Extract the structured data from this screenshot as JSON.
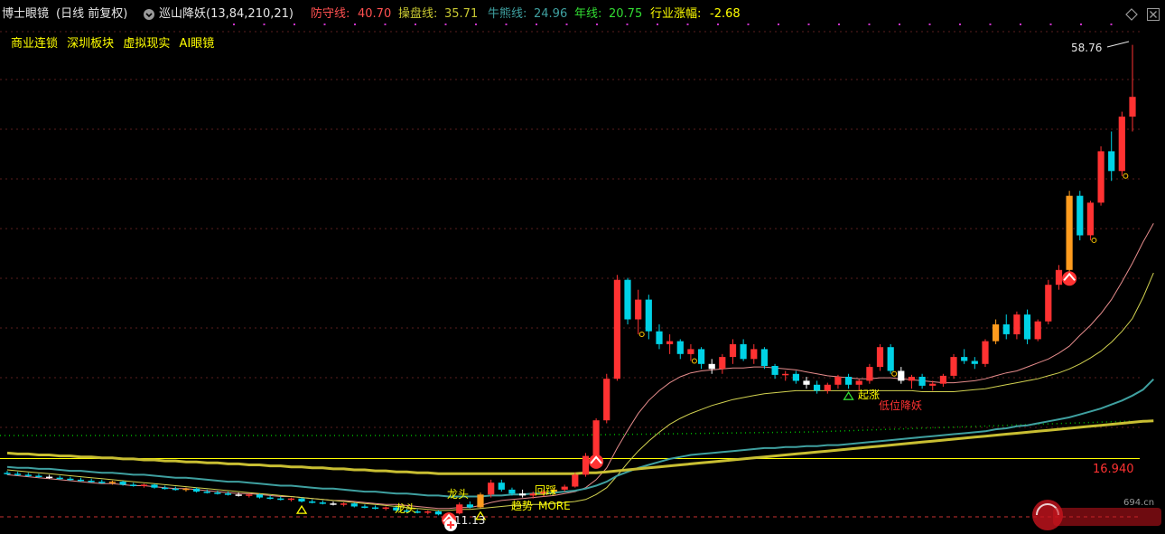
{
  "header": {
    "title": "博士眼镜",
    "period": "(日线 前复权)",
    "indicator_name": "巡山降妖(13,84,210,21)",
    "lines": [
      {
        "label": "防守线:",
        "value": "40.70",
        "color": "#ff5050"
      },
      {
        "label": "操盘线:",
        "value": "35.71",
        "color": "#c8c832"
      },
      {
        "label": "牛熊线:",
        "value": "24.96",
        "color": "#3fa0a0"
      },
      {
        "label": "年线:",
        "value": "20.75",
        "color": "#32dc32"
      },
      {
        "label": "行业涨幅:",
        "value": "-2.68",
        "color": "#ffff00"
      }
    ]
  },
  "tags": [
    "商业连锁",
    "深圳板块",
    "虚拟现实",
    "AI眼镜"
  ],
  "colors": {
    "up": "#ff3232",
    "down": "#00d2e6",
    "orange": "#ff9c1e",
    "defense": "#ff5050",
    "operate": "#c8c832",
    "bullbear": "#3fa0a0",
    "yearline": "#d2c832",
    "dotted": "#00b400"
  },
  "chart_data": {
    "type": "candlestick",
    "price_range": [
      10.5,
      60
    ],
    "max_label": "58.76",
    "min_label": "11.13",
    "level_label": "16.940",
    "level": 16.94,
    "annotations": [
      {
        "text": "龙头",
        "color": "#ffff00"
      },
      {
        "text": "龙头",
        "color": "#ffff00"
      },
      {
        "text": "回踩",
        "color": "#ffff00"
      },
      {
        "text": "趋势",
        "color": "#ffff00"
      },
      {
        "text": "MORE",
        "color": "#ffff00"
      },
      {
        "text": "起涨",
        "color": "#ffff00"
      },
      {
        "text": "低位降妖",
        "color": "#ff3232"
      }
    ],
    "ohlc_note": "open, high, low, close per day",
    "candles": [
      [
        15.5,
        15.7,
        15.3,
        15.4
      ],
      [
        15.4,
        15.6,
        15.2,
        15.3
      ],
      [
        15.3,
        15.5,
        15.1,
        15.2
      ],
      [
        15.2,
        15.4,
        15.0,
        15.1
      ],
      [
        15.1,
        15.3,
        14.9,
        15.0
      ],
      [
        15.0,
        15.2,
        14.8,
        14.9
      ],
      [
        14.9,
        15.1,
        14.7,
        14.8
      ],
      [
        14.8,
        15.0,
        14.6,
        14.7
      ],
      [
        14.7,
        14.9,
        14.5,
        14.6
      ],
      [
        14.6,
        14.8,
        14.4,
        14.5
      ],
      [
        14.5,
        14.7,
        14.3,
        14.6
      ],
      [
        14.6,
        14.7,
        14.2,
        14.3
      ],
      [
        14.3,
        14.5,
        14.1,
        14.2
      ],
      [
        14.2,
        14.4,
        14.0,
        14.3
      ],
      [
        14.3,
        14.4,
        13.9,
        14.0
      ],
      [
        14.0,
        14.2,
        13.8,
        13.9
      ],
      [
        13.9,
        14.1,
        13.7,
        13.8
      ],
      [
        13.8,
        14.0,
        13.6,
        13.9
      ],
      [
        13.9,
        14.0,
        13.5,
        13.6
      ],
      [
        13.6,
        13.8,
        13.4,
        13.5
      ],
      [
        13.5,
        13.7,
        13.3,
        13.4
      ],
      [
        13.4,
        13.6,
        13.2,
        13.3
      ],
      [
        13.3,
        13.5,
        13.1,
        13.2
      ],
      [
        13.2,
        13.4,
        13.0,
        13.3
      ],
      [
        13.3,
        13.4,
        12.9,
        13.0
      ],
      [
        13.0,
        13.2,
        12.8,
        12.9
      ],
      [
        12.9,
        13.1,
        12.7,
        12.8
      ],
      [
        12.8,
        13.0,
        12.6,
        12.9
      ],
      [
        12.9,
        13.0,
        12.5,
        12.6
      ],
      [
        12.6,
        12.8,
        12.4,
        12.5
      ],
      [
        12.5,
        12.7,
        12.3,
        12.4
      ],
      [
        12.4,
        12.6,
        12.2,
        12.3
      ],
      [
        12.3,
        12.5,
        12.1,
        12.4
      ],
      [
        12.4,
        12.5,
        12.0,
        12.1
      ],
      [
        12.1,
        12.3,
        11.9,
        12.0
      ],
      [
        12.0,
        12.2,
        11.8,
        11.9
      ],
      [
        11.9,
        12.1,
        11.7,
        12.0
      ],
      [
        12.0,
        12.1,
        11.6,
        11.7
      ],
      [
        11.7,
        11.9,
        11.5,
        11.6
      ],
      [
        11.6,
        11.8,
        11.4,
        11.5
      ],
      [
        11.5,
        11.7,
        11.3,
        11.6
      ],
      [
        11.6,
        11.7,
        11.2,
        11.3
      ],
      [
        11.3,
        11.5,
        11.13,
        11.4
      ],
      [
        11.4,
        12.5,
        11.3,
        12.3
      ],
      [
        12.3,
        12.6,
        11.9,
        12.0
      ],
      [
        12.0,
        13.5,
        11.9,
        13.3
      ],
      [
        13.3,
        14.8,
        13.0,
        14.5
      ],
      [
        14.5,
        14.8,
        13.6,
        13.8
      ],
      [
        13.8,
        14.0,
        13.2,
        13.4
      ],
      [
        13.4,
        13.8,
        13.0,
        13.2
      ],
      [
        13.2,
        13.6,
        12.9,
        13.4
      ],
      [
        13.4,
        13.8,
        13.1,
        13.6
      ],
      [
        13.6,
        14.0,
        13.3,
        13.8
      ],
      [
        13.8,
        14.3,
        13.6,
        14.1
      ],
      [
        14.1,
        15.5,
        14.0,
        15.3
      ],
      [
        15.3,
        17.5,
        15.1,
        17.2
      ],
      [
        17.2,
        21.0,
        17.0,
        20.8
      ],
      [
        20.8,
        25.5,
        20.5,
        25.0
      ],
      [
        25.0,
        35.5,
        24.8,
        35.0
      ],
      [
        35.0,
        35.2,
        30.5,
        31.0
      ],
      [
        31.0,
        34.0,
        29.5,
        33.0
      ],
      [
        33.0,
        33.5,
        29.0,
        29.8
      ],
      [
        29.8,
        30.5,
        28.0,
        28.5
      ],
      [
        28.5,
        29.5,
        27.5,
        28.8
      ],
      [
        28.8,
        29.0,
        27.0,
        27.5
      ],
      [
        27.5,
        28.5,
        26.8,
        28.0
      ],
      [
        28.0,
        28.2,
        26.0,
        26.5
      ],
      [
        26.5,
        27.0,
        25.5,
        26.0
      ],
      [
        26.0,
        27.5,
        25.5,
        27.2
      ],
      [
        27.2,
        29.0,
        26.5,
        28.5
      ],
      [
        28.5,
        29.0,
        26.8,
        27.0
      ],
      [
        27.0,
        28.5,
        26.5,
        28.0
      ],
      [
        28.0,
        28.2,
        26.0,
        26.3
      ],
      [
        26.3,
        26.5,
        25.0,
        25.4
      ],
      [
        25.4,
        25.8,
        24.8,
        25.5
      ],
      [
        25.5,
        25.8,
        24.5,
        24.8
      ],
      [
        24.8,
        25.2,
        24.0,
        24.4
      ],
      [
        24.4,
        24.8,
        23.5,
        23.8
      ],
      [
        23.8,
        24.6,
        23.5,
        24.4
      ],
      [
        24.4,
        25.4,
        24.0,
        25.2
      ],
      [
        25.2,
        25.5,
        24.0,
        24.4
      ],
      [
        24.4,
        25.0,
        23.8,
        24.8
      ],
      [
        24.8,
        26.5,
        24.5,
        26.2
      ],
      [
        26.2,
        28.5,
        25.8,
        28.2
      ],
      [
        28.2,
        28.5,
        25.5,
        25.8
      ],
      [
        25.8,
        26.2,
        24.5,
        24.8
      ],
      [
        24.8,
        25.4,
        24.0,
        25.2
      ],
      [
        25.2,
        25.5,
        24.0,
        24.3
      ],
      [
        24.3,
        24.8,
        23.8,
        24.5
      ],
      [
        24.5,
        25.5,
        24.2,
        25.3
      ],
      [
        25.3,
        27.5,
        25.0,
        27.2
      ],
      [
        27.2,
        28.0,
        26.5,
        26.8
      ],
      [
        26.8,
        27.2,
        26.0,
        26.5
      ],
      [
        26.5,
        29.0,
        26.2,
        28.8
      ],
      [
        28.8,
        31.0,
        28.5,
        30.5
      ],
      [
        30.5,
        31.5,
        29.0,
        29.5
      ],
      [
        29.5,
        31.8,
        29.0,
        31.5
      ],
      [
        31.5,
        32.0,
        28.5,
        29.0
      ],
      [
        29.0,
        31.0,
        28.8,
        30.8
      ],
      [
        30.8,
        35.0,
        30.5,
        34.5
      ],
      [
        34.5,
        36.5,
        34.0,
        36.0
      ],
      [
        36.0,
        44.0,
        35.5,
        43.5
      ],
      [
        43.5,
        44.0,
        39.0,
        39.5
      ],
      [
        39.5,
        43.0,
        39.0,
        42.8
      ],
      [
        42.8,
        48.5,
        42.5,
        48.0
      ],
      [
        48.0,
        50.0,
        45.0,
        46.0
      ],
      [
        46.0,
        52.0,
        45.5,
        51.5
      ],
      [
        51.5,
        58.76,
        50.0,
        53.5
      ]
    ],
    "series": [
      {
        "key": "defense",
        "values": [
          15.3,
          15.2,
          15.1,
          15.0,
          14.9,
          14.8,
          14.7,
          14.6,
          14.5,
          14.4,
          14.4,
          14.3,
          14.2,
          14.2,
          14.1,
          14.0,
          13.9,
          13.9,
          13.8,
          13.7,
          13.6,
          13.5,
          13.4,
          13.4,
          13.3,
          13.2,
          13.1,
          13.1,
          13.0,
          12.9,
          12.8,
          12.7,
          12.7,
          12.6,
          12.5,
          12.4,
          12.3,
          12.3,
          12.2,
          12.1,
          12.0,
          11.9,
          11.9,
          12.0,
          12.0,
          12.2,
          12.5,
          12.7,
          12.8,
          12.9,
          13.0,
          13.1,
          13.2,
          13.4,
          13.6,
          14.0,
          14.8,
          16.0,
          18.0,
          19.8,
          21.5,
          22.8,
          23.8,
          24.6,
          25.2,
          25.6,
          25.8,
          25.9,
          26.0,
          26.1,
          26.1,
          26.2,
          26.2,
          26.1,
          26.0,
          25.9,
          25.7,
          25.5,
          25.3,
          25.2,
          25.1,
          25.0,
          25.0,
          25.1,
          25.1,
          25.0,
          24.9,
          24.8,
          24.7,
          24.6,
          24.6,
          24.7,
          24.8,
          25.0,
          25.3,
          25.6,
          25.8,
          26.2,
          26.6,
          27.0,
          27.6,
          28.3,
          29.4,
          30.4,
          31.6,
          33.0,
          34.8,
          36.7,
          38.8,
          40.7
        ]
      },
      {
        "key": "operate",
        "values": [
          15.8,
          15.7,
          15.6,
          15.5,
          15.4,
          15.3,
          15.2,
          15.1,
          15.0,
          14.9,
          14.8,
          14.7,
          14.6,
          14.5,
          14.4,
          14.3,
          14.2,
          14.1,
          14.0,
          13.9,
          13.8,
          13.7,
          13.6,
          13.5,
          13.4,
          13.3,
          13.2,
          13.1,
          13.0,
          12.9,
          12.8,
          12.7,
          12.6,
          12.5,
          12.4,
          12.3,
          12.2,
          12.1,
          12.0,
          11.9,
          11.8,
          11.7,
          11.7,
          11.8,
          11.8,
          11.9,
          12.0,
          12.1,
          12.2,
          12.2,
          12.3,
          12.3,
          12.4,
          12.5,
          12.6,
          12.8,
          13.3,
          14.0,
          15.2,
          16.5,
          17.7,
          18.7,
          19.6,
          20.4,
          21.0,
          21.5,
          21.9,
          22.3,
          22.6,
          22.9,
          23.1,
          23.3,
          23.5,
          23.6,
          23.7,
          23.8,
          23.8,
          23.8,
          23.8,
          23.8,
          23.8,
          23.8,
          23.8,
          23.8,
          23.8,
          23.8,
          23.8,
          23.7,
          23.7,
          23.7,
          23.7,
          23.8,
          23.9,
          24.0,
          24.2,
          24.4,
          24.6,
          24.8,
          25.0,
          25.3,
          25.6,
          26.0,
          26.5,
          27.1,
          27.8,
          28.7,
          29.8,
          31.1,
          33.2,
          35.7
        ]
      },
      {
        "key": "bullbear",
        "values": [
          16.1,
          16.0,
          16.0,
          15.9,
          15.9,
          15.8,
          15.7,
          15.7,
          15.6,
          15.5,
          15.5,
          15.4,
          15.3,
          15.3,
          15.2,
          15.1,
          15.0,
          15.0,
          14.9,
          14.8,
          14.7,
          14.6,
          14.6,
          14.5,
          14.4,
          14.3,
          14.2,
          14.2,
          14.1,
          14.0,
          13.9,
          13.9,
          13.8,
          13.7,
          13.6,
          13.6,
          13.5,
          13.4,
          13.4,
          13.3,
          13.2,
          13.2,
          13.1,
          13.1,
          13.1,
          13.1,
          13.2,
          13.2,
          13.3,
          13.3,
          13.4,
          13.4,
          13.5,
          13.6,
          13.7,
          13.9,
          14.2,
          14.6,
          15.2,
          15.6,
          16.0,
          16.3,
          16.6,
          16.9,
          17.1,
          17.3,
          17.4,
          17.5,
          17.6,
          17.7,
          17.8,
          17.9,
          18.0,
          18.0,
          18.1,
          18.1,
          18.2,
          18.2,
          18.3,
          18.3,
          18.4,
          18.5,
          18.6,
          18.7,
          18.8,
          18.9,
          19.0,
          19.1,
          19.2,
          19.3,
          19.4,
          19.5,
          19.6,
          19.7,
          19.9,
          20.0,
          20.2,
          20.3,
          20.5,
          20.7,
          20.9,
          21.1,
          21.4,
          21.7,
          22.0,
          22.4,
          22.8,
          23.3,
          23.9,
          24.96
        ]
      },
      {
        "key": "yearline",
        "values": [
          17.5,
          17.4,
          17.4,
          17.3,
          17.3,
          17.2,
          17.2,
          17.1,
          17.1,
          17.0,
          17.0,
          16.9,
          16.9,
          16.8,
          16.8,
          16.7,
          16.7,
          16.6,
          16.6,
          16.5,
          16.5,
          16.4,
          16.4,
          16.3,
          16.3,
          16.2,
          16.2,
          16.1,
          16.1,
          16.0,
          16.0,
          15.9,
          15.9,
          15.8,
          15.8,
          15.7,
          15.7,
          15.6,
          15.6,
          15.5,
          15.5,
          15.4,
          15.4,
          15.4,
          15.4,
          15.4,
          15.4,
          15.4,
          15.4,
          15.4,
          15.4,
          15.4,
          15.4,
          15.4,
          15.4,
          15.5,
          15.5,
          15.6,
          15.7,
          15.8,
          15.9,
          16.0,
          16.1,
          16.2,
          16.3,
          16.4,
          16.5,
          16.6,
          16.7,
          16.8,
          16.9,
          17.0,
          17.1,
          17.2,
          17.3,
          17.4,
          17.5,
          17.6,
          17.7,
          17.8,
          17.9,
          18.0,
          18.1,
          18.2,
          18.3,
          18.4,
          18.5,
          18.6,
          18.7,
          18.8,
          18.9,
          19.0,
          19.1,
          19.2,
          19.3,
          19.4,
          19.5,
          19.6,
          19.7,
          19.8,
          19.9,
          20.0,
          20.1,
          20.2,
          20.3,
          20.4,
          20.5,
          20.6,
          20.7,
          20.75
        ]
      }
    ]
  }
}
